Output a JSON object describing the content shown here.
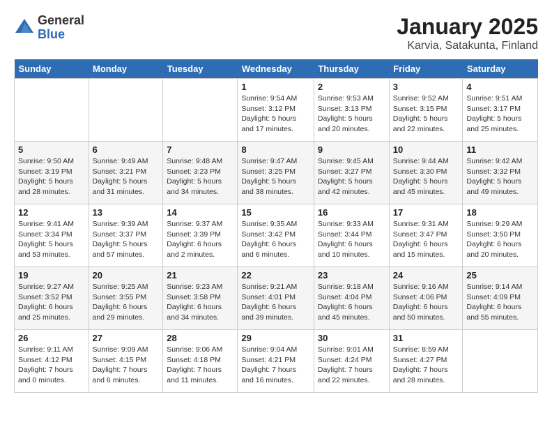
{
  "logo": {
    "general": "General",
    "blue": "Blue"
  },
  "title": "January 2025",
  "subtitle": "Karvia, Satakunta, Finland",
  "weekdays": [
    "Sunday",
    "Monday",
    "Tuesday",
    "Wednesday",
    "Thursday",
    "Friday",
    "Saturday"
  ],
  "weeks": [
    [
      {
        "day": "",
        "info": ""
      },
      {
        "day": "",
        "info": ""
      },
      {
        "day": "",
        "info": ""
      },
      {
        "day": "1",
        "info": "Sunrise: 9:54 AM\nSunset: 3:12 PM\nDaylight: 5 hours and 17 minutes."
      },
      {
        "day": "2",
        "info": "Sunrise: 9:53 AM\nSunset: 3:13 PM\nDaylight: 5 hours and 20 minutes."
      },
      {
        "day": "3",
        "info": "Sunrise: 9:52 AM\nSunset: 3:15 PM\nDaylight: 5 hours and 22 minutes."
      },
      {
        "day": "4",
        "info": "Sunrise: 9:51 AM\nSunset: 3:17 PM\nDaylight: 5 hours and 25 minutes."
      }
    ],
    [
      {
        "day": "5",
        "info": "Sunrise: 9:50 AM\nSunset: 3:19 PM\nDaylight: 5 hours and 28 minutes."
      },
      {
        "day": "6",
        "info": "Sunrise: 9:49 AM\nSunset: 3:21 PM\nDaylight: 5 hours and 31 minutes."
      },
      {
        "day": "7",
        "info": "Sunrise: 9:48 AM\nSunset: 3:23 PM\nDaylight: 5 hours and 34 minutes."
      },
      {
        "day": "8",
        "info": "Sunrise: 9:47 AM\nSunset: 3:25 PM\nDaylight: 5 hours and 38 minutes."
      },
      {
        "day": "9",
        "info": "Sunrise: 9:45 AM\nSunset: 3:27 PM\nDaylight: 5 hours and 42 minutes."
      },
      {
        "day": "10",
        "info": "Sunrise: 9:44 AM\nSunset: 3:30 PM\nDaylight: 5 hours and 45 minutes."
      },
      {
        "day": "11",
        "info": "Sunrise: 9:42 AM\nSunset: 3:32 PM\nDaylight: 5 hours and 49 minutes."
      }
    ],
    [
      {
        "day": "12",
        "info": "Sunrise: 9:41 AM\nSunset: 3:34 PM\nDaylight: 5 hours and 53 minutes."
      },
      {
        "day": "13",
        "info": "Sunrise: 9:39 AM\nSunset: 3:37 PM\nDaylight: 5 hours and 57 minutes."
      },
      {
        "day": "14",
        "info": "Sunrise: 9:37 AM\nSunset: 3:39 PM\nDaylight: 6 hours and 2 minutes."
      },
      {
        "day": "15",
        "info": "Sunrise: 9:35 AM\nSunset: 3:42 PM\nDaylight: 6 hours and 6 minutes."
      },
      {
        "day": "16",
        "info": "Sunrise: 9:33 AM\nSunset: 3:44 PM\nDaylight: 6 hours and 10 minutes."
      },
      {
        "day": "17",
        "info": "Sunrise: 9:31 AM\nSunset: 3:47 PM\nDaylight: 6 hours and 15 minutes."
      },
      {
        "day": "18",
        "info": "Sunrise: 9:29 AM\nSunset: 3:50 PM\nDaylight: 6 hours and 20 minutes."
      }
    ],
    [
      {
        "day": "19",
        "info": "Sunrise: 9:27 AM\nSunset: 3:52 PM\nDaylight: 6 hours and 25 minutes."
      },
      {
        "day": "20",
        "info": "Sunrise: 9:25 AM\nSunset: 3:55 PM\nDaylight: 6 hours and 29 minutes."
      },
      {
        "day": "21",
        "info": "Sunrise: 9:23 AM\nSunset: 3:58 PM\nDaylight: 6 hours and 34 minutes."
      },
      {
        "day": "22",
        "info": "Sunrise: 9:21 AM\nSunset: 4:01 PM\nDaylight: 6 hours and 39 minutes."
      },
      {
        "day": "23",
        "info": "Sunrise: 9:18 AM\nSunset: 4:04 PM\nDaylight: 6 hours and 45 minutes."
      },
      {
        "day": "24",
        "info": "Sunrise: 9:16 AM\nSunset: 4:06 PM\nDaylight: 6 hours and 50 minutes."
      },
      {
        "day": "25",
        "info": "Sunrise: 9:14 AM\nSunset: 4:09 PM\nDaylight: 6 hours and 55 minutes."
      }
    ],
    [
      {
        "day": "26",
        "info": "Sunrise: 9:11 AM\nSunset: 4:12 PM\nDaylight: 7 hours and 0 minutes."
      },
      {
        "day": "27",
        "info": "Sunrise: 9:09 AM\nSunset: 4:15 PM\nDaylight: 7 hours and 6 minutes."
      },
      {
        "day": "28",
        "info": "Sunrise: 9:06 AM\nSunset: 4:18 PM\nDaylight: 7 hours and 11 minutes."
      },
      {
        "day": "29",
        "info": "Sunrise: 9:04 AM\nSunset: 4:21 PM\nDaylight: 7 hours and 16 minutes."
      },
      {
        "day": "30",
        "info": "Sunrise: 9:01 AM\nSunset: 4:24 PM\nDaylight: 7 hours and 22 minutes."
      },
      {
        "day": "31",
        "info": "Sunrise: 8:59 AM\nSunset: 4:27 PM\nDaylight: 7 hours and 28 minutes."
      },
      {
        "day": "",
        "info": ""
      }
    ]
  ]
}
